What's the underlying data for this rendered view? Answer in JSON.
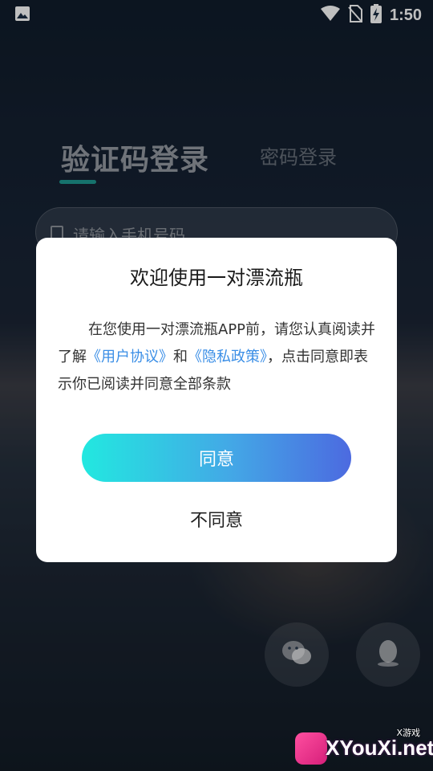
{
  "status_bar": {
    "time": "1:50",
    "icons": [
      "image-notification-icon",
      "wifi-icon",
      "no-sim-icon",
      "battery-charging-icon"
    ]
  },
  "login": {
    "tab_active": "验证码登录",
    "tab_inactive": "密码登录",
    "phone_placeholder": "请输入手机号码",
    "accent_color": "#20b8a8"
  },
  "social_login": [
    "wechat-icon",
    "qq-icon"
  ],
  "dialog": {
    "title": "欢迎使用一对漂流瓶",
    "body_prefix": "在您使用一对漂流瓶APP前，请您认真阅读并了解",
    "link_user_agreement": "《用户协议》",
    "and": "和",
    "link_privacy_policy": "《隐私政策》",
    "body_suffix": "，点击同意即表示你已阅读并同意全部条款",
    "agree_label": "同意",
    "disagree_label": "不同意",
    "link_color": "#3a8ee6"
  },
  "watermark": {
    "site": "XYouXi.net",
    "tag": "X游戏"
  }
}
